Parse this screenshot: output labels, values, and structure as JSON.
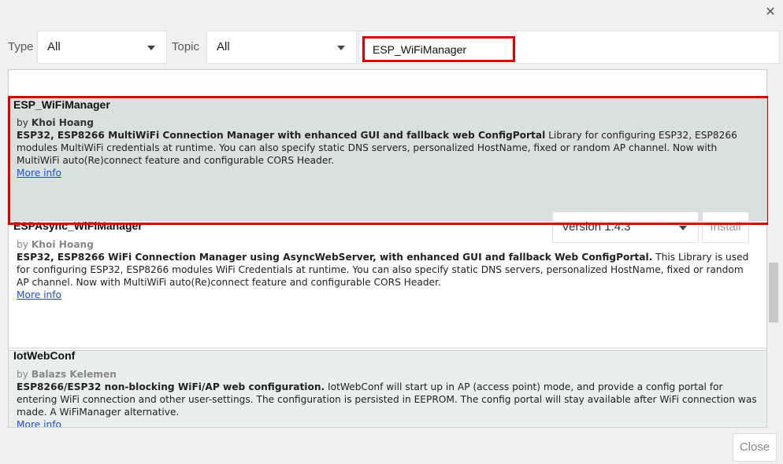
{
  "window": {
    "close_glyph": "✕"
  },
  "filters": {
    "type_label": "Type",
    "type_value": "All",
    "topic_label": "Topic",
    "topic_value": "All",
    "search_value": "ESP_WiFiManager"
  },
  "libraries": [
    {
      "name": "ESP_WiFiManager",
      "by_prefix": "by",
      "author": "Khoi Hoang",
      "summary": "ESP32, ESP8266 MultiWiFi Connection Manager with enhanced GUI and fallback web ConfigPortal",
      "description": "Library for configuring ESP32, ESP8266 modules MultiWiFi credentials at runtime. You can also specify static DNS servers, personalized HostName, fixed or random AP channel. Now with MultiWiFi auto(Re)connect feature and configurable CORS Header.",
      "more_info": "More info",
      "version": "Version 1.4.3",
      "install_label": "Install"
    },
    {
      "name": "ESPAsync_WiFiManager",
      "by_prefix": "by",
      "author": "Khoi Hoang",
      "summary": "ESP32, ESP8266 WiFi Connection Manager using AsyncWebServer, with enhanced GUI and fallback Web ConfigPortal.",
      "description": "This Library is used for configuring ESP32, ESP8266 modules WiFi Credentials at runtime. You can also specify static DNS servers, personalized HostName, fixed or random AP channel. Now with MultiWiFi auto(Re)connect feature and configurable CORS Header.",
      "more_info": "More info"
    },
    {
      "name": "IotWebConf",
      "by_prefix": "by",
      "author": "Balazs Kelemen",
      "summary": "ESP8266/ESP32 non-blocking WiFi/AP web configuration.",
      "description": "IotWebConf will start up in AP (access point) mode, and provide a config portal for entering WiFi connection and other user-settings. The configuration is persisted in EEPROM. The config portal will stay available after WiFi connection was made. A WiFiManager alternative.",
      "more_info": "More info"
    }
  ],
  "footer": {
    "close_label": "Close"
  },
  "colors": {
    "highlight": "#e00000",
    "link": "#1a4fd6",
    "selected_bg": "#d8e0e0"
  }
}
